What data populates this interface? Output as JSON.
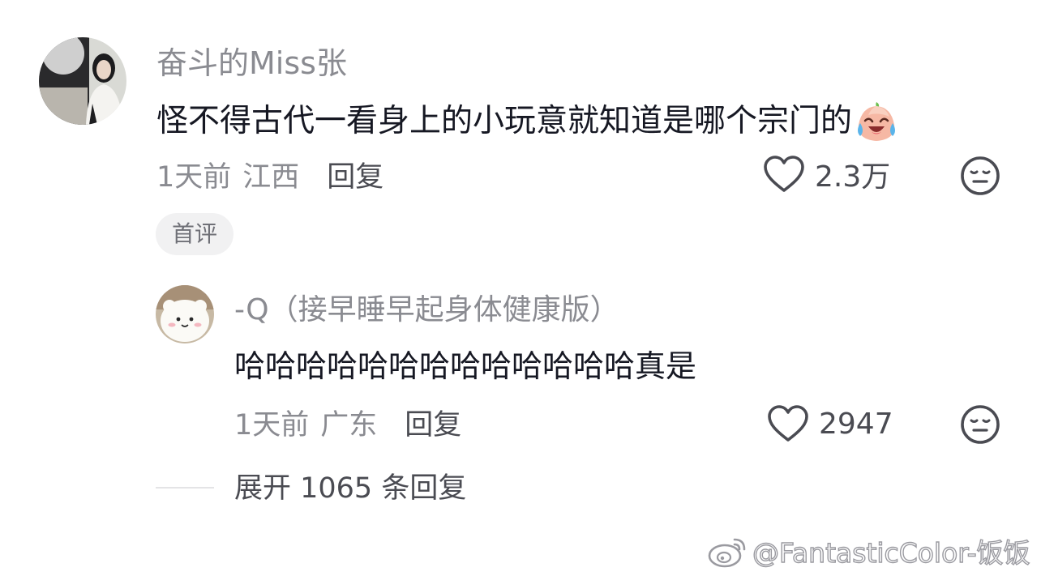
{
  "main_comment": {
    "author": "奋斗的Miss张",
    "text": "怪不得古代一看身上的小玩意就知道是哪个宗门的",
    "emoji": "laughing-crying-emoji",
    "time": "1天前",
    "location": "江西",
    "reply_label": "回复",
    "like_count": "2.3万",
    "badge": "首评"
  },
  "reply_comment": {
    "author": "-Q（接早睡早起身体健康版）",
    "text": "哈哈哈哈哈哈哈哈哈哈哈哈哈真是",
    "time": "1天前",
    "location": "广东",
    "reply_label": "回复",
    "like_count": "2947"
  },
  "expand": {
    "label": "展开 1065 条回复"
  },
  "watermark": {
    "text": "@FantasticColor-饭饭"
  },
  "icons": {
    "like": "heart-outline-icon",
    "dislike": "neutral-face-icon",
    "watermark_logo": "weibo-logo-icon"
  },
  "colors": {
    "primary_text": "#161823",
    "secondary_text": "#8a8b91",
    "action_text": "#4a4b52",
    "badge_bg": "#f1f1f2"
  }
}
